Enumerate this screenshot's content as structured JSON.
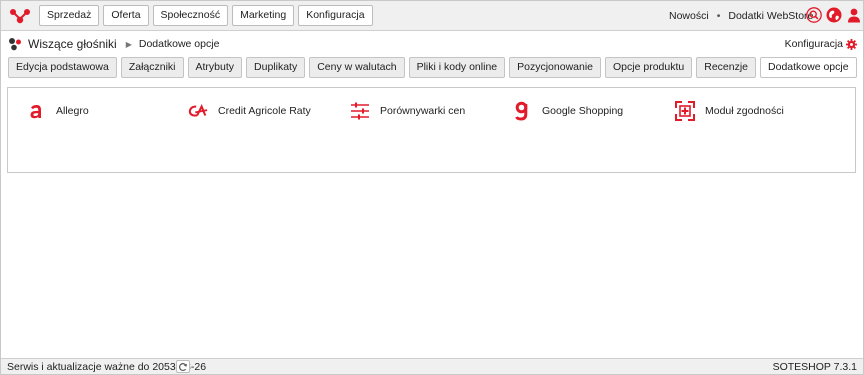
{
  "nav": {
    "items": [
      "Sprzedaż",
      "Oferta",
      "Społeczność",
      "Marketing",
      "Konfiguracja"
    ]
  },
  "top_links": {
    "news": "Nowości",
    "webstore": "Dodatki WebStore"
  },
  "top_icons": [
    "search-icon",
    "globe-icon",
    "user-icon"
  ],
  "breadcrumb": {
    "title": "Wiszące głośniki",
    "current": "Dodatkowe opcje"
  },
  "config_link": {
    "label": "Konfiguracja"
  },
  "tabs": [
    "Edycja podstawowa",
    "Załączniki",
    "Atrybuty",
    "Duplikaty",
    "Ceny w walutach",
    "Pliki i kody online",
    "Pozycjonowanie",
    "Opcje produktu",
    "Recenzje",
    "Dodatkowe opcje"
  ],
  "active_tab": "Dodatkowe opcje",
  "options": [
    {
      "label": "Allegro",
      "icon": "allegro-icon"
    },
    {
      "label": "Credit Agricole Raty",
      "icon": "credit-agricole-icon"
    },
    {
      "label": "Porównywarki cen",
      "icon": "sliders-icon"
    },
    {
      "label": "Google Shopping",
      "icon": "google-icon"
    },
    {
      "label": "Moduł zgodności",
      "icon": "compliance-icon"
    }
  ],
  "status": {
    "text": "Serwis i aktualizacje ważne do 2053-08-26",
    "version": "SOTESHOP 7.3.1"
  },
  "colors": {
    "accent": "#e21b2b",
    "bar": "#f0f0f0",
    "border": "#c9c9c9"
  }
}
